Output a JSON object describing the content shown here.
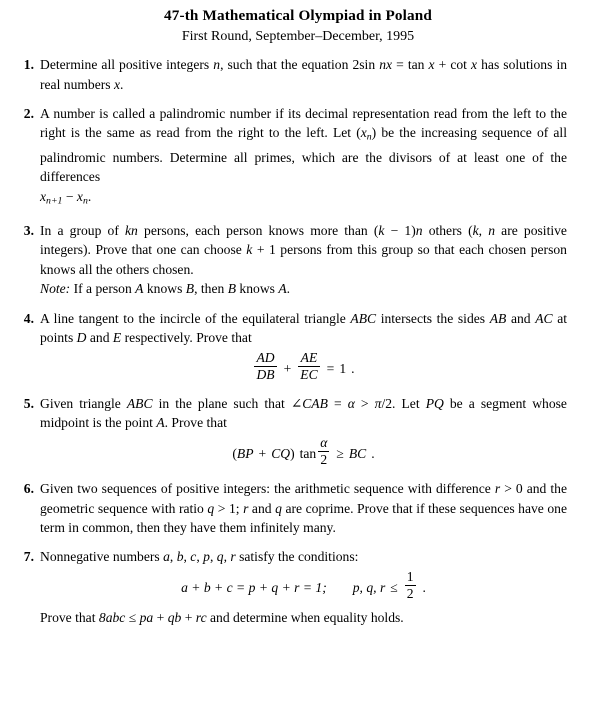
{
  "header": {
    "title": "47-th Mathematical Olympiad in Poland",
    "subtitle": "First Round, September–December, 1995"
  },
  "problems": [
    {
      "number": "1.",
      "text_parts": {
        "lead": "Determine all positive integers",
        "var_n": "n",
        "mid": ", such that the equation",
        "eq_coef": "2",
        "eq_sin": "sin",
        "eq_arg": "nx",
        "eq_equals": "=",
        "eq_tan": "tan",
        "eq_x1": "x",
        "eq_plus": "+",
        "eq_cot": "cot",
        "eq_x2": "x",
        "tail": "has solutions in real numbers",
        "var_x": "x",
        "period": "."
      }
    },
    {
      "number": "2.",
      "text_parts": {
        "p1": "A number is called a palindromic number if its decimal representation read from the left to the right is the same as read from the right to the left. Let (",
        "seq_x": "x",
        "seq_sub": "n",
        "p2": ") be the increasing sequence of all palindromic numbers. Determine all primes, which are the divisors of at least one of the differences",
        "disp_x1": "x",
        "disp_sub1": "n+1",
        "disp_minus": "−",
        "disp_x2": "x",
        "disp_sub2": "n",
        "disp_period": "."
      }
    },
    {
      "number": "3.",
      "text_parts": {
        "p1": "In a group of",
        "kn": "kn",
        "p2": "persons, each person knows more than (",
        "k1": "k",
        "p3": "− 1)",
        "n1": "n",
        "p4": "others (",
        "k2": "k",
        "p5": ",",
        "n2": "n",
        "p6": "are positive integers). Prove that one can choose",
        "k3": "k",
        "p7": "+ 1 persons from this group so that each chosen person knows all the others chosen.",
        "note_label": "Note:",
        "note_p1": "If a person",
        "note_A1": "A",
        "note_p2": "knows",
        "note_B1": "B",
        "note_p3": ", then",
        "note_B2": "B",
        "note_p4": "knows",
        "note_A2": "A",
        "note_p5": "."
      }
    },
    {
      "number": "4.",
      "text_parts": {
        "p1": "A line tangent to the incircle of the equilateral triangle",
        "abc": "ABC",
        "p2": "intersects the sides",
        "ab": "AB",
        "p3": "and",
        "ac": "AC",
        "p4": "at points",
        "d": "D",
        "p5": "and",
        "e": "E",
        "p6": "respectively. Prove that"
      },
      "display": {
        "frac1_num": "AD",
        "frac1_den": "DB",
        "plus": "+",
        "frac2_num": "AE",
        "frac2_den": "EC",
        "equals": "=",
        "rhs": "1",
        "period": "."
      }
    },
    {
      "number": "5.",
      "text_parts": {
        "p1": "Given triangle",
        "abc": "ABC",
        "p2": "in the plane such that ∠",
        "cab": "CAB",
        "p3": "=",
        "alpha": "α",
        "p4": ">",
        "pi": "π",
        "p5": "/2. Let",
        "pq": "PQ",
        "p6": "be a segment whose midpoint is the point",
        "a": "A",
        "p7": ". Prove that"
      },
      "display": {
        "lparen": "(",
        "bp": "BP",
        "plus": "+",
        "cq": "CQ",
        "rparen": ")",
        "tan": "tan",
        "frac_num": "α",
        "frac_den": "2",
        "geq": "≥",
        "bc": "BC",
        "period": "."
      }
    },
    {
      "number": "6.",
      "text_parts": {
        "p1": "Given two sequences of positive integers: the arithmetic sequence with difference",
        "r1": "r",
        "p2": "> 0 and the geometric sequence with ratio",
        "q1": "q",
        "p3": "> 1;",
        "r2": "r",
        "p4": "and",
        "q2": "q",
        "p5": "are coprime. Prove that if these sequences have one term in common, then they have them infinitely many."
      }
    },
    {
      "number": "7.",
      "text_parts": {
        "p1": "Nonnegative numbers",
        "a": "a",
        "c1": ",",
        "b": "b",
        "c2": ",",
        "c": "c",
        "c3": ",",
        "p": "p",
        "c4": ",",
        "q": "q",
        "c5": ",",
        "r": "r",
        "p2": "satisfy the conditions:"
      },
      "display": {
        "lhs": "a + b + c = p + q + r = 1;",
        "vars": "p, q, r",
        "leq": "≤",
        "frac_num": "1",
        "frac_den": "2",
        "period": "."
      },
      "closing": {
        "p1": "Prove that",
        "expr1": "8abc",
        "leq": "≤",
        "expr2": "pa",
        "plus1": "+",
        "expr3": "qb",
        "plus2": "+",
        "expr4": "rc",
        "p2": "and determine when equality holds."
      }
    }
  ]
}
